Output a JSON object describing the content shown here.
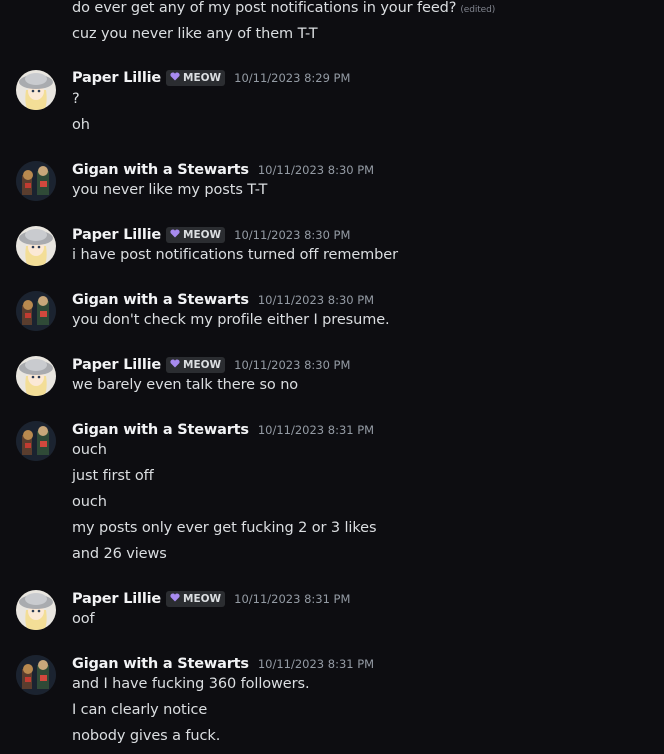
{
  "colors": {
    "background": "#0d0d11",
    "text": "#dbdee1",
    "author": "#f2f3f5",
    "timestamp": "#949ba4",
    "tag_bg": "#2b2d31",
    "heart": "#a88bf0"
  },
  "top": {
    "lines": [
      "do ever get any of my post notifications in your feed?",
      "cuz you never like any  of them T-T"
    ],
    "edited_label": "(edited)"
  },
  "messages": [
    {
      "author": "Paper Lillie",
      "tag": "MEOW",
      "timestamp": "10/11/2023 8:29 PM",
      "lines": [
        "?",
        "oh"
      ]
    },
    {
      "author": "Gigan with a Stewarts",
      "timestamp": "10/11/2023 8:30 PM",
      "lines": [
        "you never like my posts T-T"
      ]
    },
    {
      "author": "Paper Lillie",
      "tag": "MEOW",
      "timestamp": "10/11/2023 8:30 PM",
      "lines": [
        "i have post notifications turned off remember"
      ]
    },
    {
      "author": "Gigan with a Stewarts",
      "timestamp": "10/11/2023 8:30 PM",
      "lines": [
        "you don't check my profile either I presume."
      ]
    },
    {
      "author": "Paper Lillie",
      "tag": "MEOW",
      "timestamp": "10/11/2023 8:30 PM",
      "lines": [
        "we barely even talk there so no"
      ]
    },
    {
      "author": "Gigan with a Stewarts",
      "timestamp": "10/11/2023 8:31 PM",
      "lines": [
        "ouch",
        "just first off",
        "ouch",
        "my posts only ever get fucking 2 or 3 likes",
        "and 26 views"
      ]
    },
    {
      "author": "Paper Lillie",
      "tag": "MEOW",
      "timestamp": "10/11/2023 8:31 PM",
      "lines": [
        "oof"
      ]
    },
    {
      "author": "Gigan with a Stewarts",
      "timestamp": "10/11/2023 8:31 PM",
      "lines": [
        "and I have fucking 360 followers.",
        "I can clearly notice",
        "nobody gives a fuck."
      ]
    }
  ]
}
